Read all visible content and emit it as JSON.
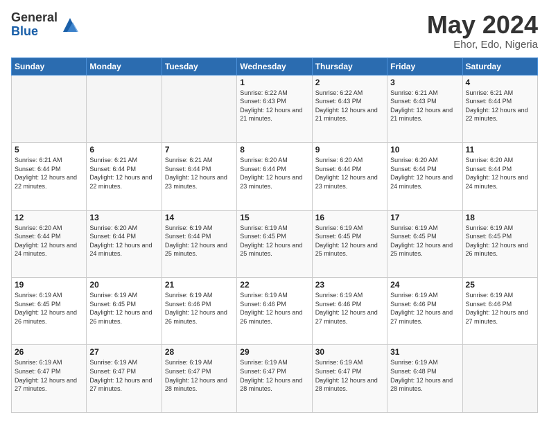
{
  "header": {
    "logo_general": "General",
    "logo_blue": "Blue",
    "month_title": "May 2024",
    "location": "Ehor, Edo, Nigeria"
  },
  "days_of_week": [
    "Sunday",
    "Monday",
    "Tuesday",
    "Wednesday",
    "Thursday",
    "Friday",
    "Saturday"
  ],
  "weeks": [
    [
      {
        "day": "",
        "sunrise": "",
        "sunset": "",
        "daylight": ""
      },
      {
        "day": "",
        "sunrise": "",
        "sunset": "",
        "daylight": ""
      },
      {
        "day": "",
        "sunrise": "",
        "sunset": "",
        "daylight": ""
      },
      {
        "day": "1",
        "sunrise": "Sunrise: 6:22 AM",
        "sunset": "Sunset: 6:43 PM",
        "daylight": "Daylight: 12 hours and 21 minutes."
      },
      {
        "day": "2",
        "sunrise": "Sunrise: 6:22 AM",
        "sunset": "Sunset: 6:43 PM",
        "daylight": "Daylight: 12 hours and 21 minutes."
      },
      {
        "day": "3",
        "sunrise": "Sunrise: 6:21 AM",
        "sunset": "Sunset: 6:43 PM",
        "daylight": "Daylight: 12 hours and 21 minutes."
      },
      {
        "day": "4",
        "sunrise": "Sunrise: 6:21 AM",
        "sunset": "Sunset: 6:44 PM",
        "daylight": "Daylight: 12 hours and 22 minutes."
      }
    ],
    [
      {
        "day": "5",
        "sunrise": "Sunrise: 6:21 AM",
        "sunset": "Sunset: 6:44 PM",
        "daylight": "Daylight: 12 hours and 22 minutes."
      },
      {
        "day": "6",
        "sunrise": "Sunrise: 6:21 AM",
        "sunset": "Sunset: 6:44 PM",
        "daylight": "Daylight: 12 hours and 22 minutes."
      },
      {
        "day": "7",
        "sunrise": "Sunrise: 6:21 AM",
        "sunset": "Sunset: 6:44 PM",
        "daylight": "Daylight: 12 hours and 23 minutes."
      },
      {
        "day": "8",
        "sunrise": "Sunrise: 6:20 AM",
        "sunset": "Sunset: 6:44 PM",
        "daylight": "Daylight: 12 hours and 23 minutes."
      },
      {
        "day": "9",
        "sunrise": "Sunrise: 6:20 AM",
        "sunset": "Sunset: 6:44 PM",
        "daylight": "Daylight: 12 hours and 23 minutes."
      },
      {
        "day": "10",
        "sunrise": "Sunrise: 6:20 AM",
        "sunset": "Sunset: 6:44 PM",
        "daylight": "Daylight: 12 hours and 24 minutes."
      },
      {
        "day": "11",
        "sunrise": "Sunrise: 6:20 AM",
        "sunset": "Sunset: 6:44 PM",
        "daylight": "Daylight: 12 hours and 24 minutes."
      }
    ],
    [
      {
        "day": "12",
        "sunrise": "Sunrise: 6:20 AM",
        "sunset": "Sunset: 6:44 PM",
        "daylight": "Daylight: 12 hours and 24 minutes."
      },
      {
        "day": "13",
        "sunrise": "Sunrise: 6:20 AM",
        "sunset": "Sunset: 6:44 PM",
        "daylight": "Daylight: 12 hours and 24 minutes."
      },
      {
        "day": "14",
        "sunrise": "Sunrise: 6:19 AM",
        "sunset": "Sunset: 6:44 PM",
        "daylight": "Daylight: 12 hours and 25 minutes."
      },
      {
        "day": "15",
        "sunrise": "Sunrise: 6:19 AM",
        "sunset": "Sunset: 6:45 PM",
        "daylight": "Daylight: 12 hours and 25 minutes."
      },
      {
        "day": "16",
        "sunrise": "Sunrise: 6:19 AM",
        "sunset": "Sunset: 6:45 PM",
        "daylight": "Daylight: 12 hours and 25 minutes."
      },
      {
        "day": "17",
        "sunrise": "Sunrise: 6:19 AM",
        "sunset": "Sunset: 6:45 PM",
        "daylight": "Daylight: 12 hours and 25 minutes."
      },
      {
        "day": "18",
        "sunrise": "Sunrise: 6:19 AM",
        "sunset": "Sunset: 6:45 PM",
        "daylight": "Daylight: 12 hours and 26 minutes."
      }
    ],
    [
      {
        "day": "19",
        "sunrise": "Sunrise: 6:19 AM",
        "sunset": "Sunset: 6:45 PM",
        "daylight": "Daylight: 12 hours and 26 minutes."
      },
      {
        "day": "20",
        "sunrise": "Sunrise: 6:19 AM",
        "sunset": "Sunset: 6:45 PM",
        "daylight": "Daylight: 12 hours and 26 minutes."
      },
      {
        "day": "21",
        "sunrise": "Sunrise: 6:19 AM",
        "sunset": "Sunset: 6:46 PM",
        "daylight": "Daylight: 12 hours and 26 minutes."
      },
      {
        "day": "22",
        "sunrise": "Sunrise: 6:19 AM",
        "sunset": "Sunset: 6:46 PM",
        "daylight": "Daylight: 12 hours and 26 minutes."
      },
      {
        "day": "23",
        "sunrise": "Sunrise: 6:19 AM",
        "sunset": "Sunset: 6:46 PM",
        "daylight": "Daylight: 12 hours and 27 minutes."
      },
      {
        "day": "24",
        "sunrise": "Sunrise: 6:19 AM",
        "sunset": "Sunset: 6:46 PM",
        "daylight": "Daylight: 12 hours and 27 minutes."
      },
      {
        "day": "25",
        "sunrise": "Sunrise: 6:19 AM",
        "sunset": "Sunset: 6:46 PM",
        "daylight": "Daylight: 12 hours and 27 minutes."
      }
    ],
    [
      {
        "day": "26",
        "sunrise": "Sunrise: 6:19 AM",
        "sunset": "Sunset: 6:47 PM",
        "daylight": "Daylight: 12 hours and 27 minutes."
      },
      {
        "day": "27",
        "sunrise": "Sunrise: 6:19 AM",
        "sunset": "Sunset: 6:47 PM",
        "daylight": "Daylight: 12 hours and 27 minutes."
      },
      {
        "day": "28",
        "sunrise": "Sunrise: 6:19 AM",
        "sunset": "Sunset: 6:47 PM",
        "daylight": "Daylight: 12 hours and 28 minutes."
      },
      {
        "day": "29",
        "sunrise": "Sunrise: 6:19 AM",
        "sunset": "Sunset: 6:47 PM",
        "daylight": "Daylight: 12 hours and 28 minutes."
      },
      {
        "day": "30",
        "sunrise": "Sunrise: 6:19 AM",
        "sunset": "Sunset: 6:47 PM",
        "daylight": "Daylight: 12 hours and 28 minutes."
      },
      {
        "day": "31",
        "sunrise": "Sunrise: 6:19 AM",
        "sunset": "Sunset: 6:48 PM",
        "daylight": "Daylight: 12 hours and 28 minutes."
      },
      {
        "day": "",
        "sunrise": "",
        "sunset": "",
        "daylight": ""
      }
    ]
  ]
}
